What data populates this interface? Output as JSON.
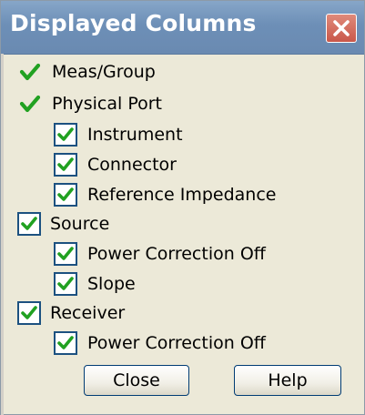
{
  "window": {
    "title": "Displayed Columns",
    "close_icon": "close-x-icon"
  },
  "colors": {
    "titlebar": "#6d8fb7",
    "check_green": "#21a121",
    "box_border": "#1c5180",
    "background": "#ece9d8"
  },
  "items": [
    {
      "label": "Meas/Group",
      "checked": true,
      "style": "plain",
      "icon": "checkmark-icon"
    },
    {
      "label": "Physical Port",
      "checked": true,
      "style": "plain",
      "icon": "checkmark-icon"
    },
    {
      "label": "Instrument",
      "checked": true,
      "style": "checkbox",
      "icon": "checkmark-icon"
    },
    {
      "label": "Connector",
      "checked": true,
      "style": "checkbox",
      "icon": "checkmark-icon"
    },
    {
      "label": "Reference Impedance",
      "checked": true,
      "style": "checkbox",
      "icon": "checkmark-icon"
    },
    {
      "label": "Source",
      "checked": true,
      "style": "checkbox",
      "icon": "checkmark-icon"
    },
    {
      "label": "Power Correction Off",
      "checked": true,
      "style": "checkbox",
      "icon": "checkmark-icon"
    },
    {
      "label": "Slope",
      "checked": true,
      "style": "checkbox",
      "icon": "checkmark-icon"
    },
    {
      "label": "Receiver",
      "checked": true,
      "style": "checkbox",
      "icon": "checkmark-icon"
    },
    {
      "label": "Power Correction Off",
      "checked": true,
      "style": "checkbox",
      "icon": "checkmark-icon"
    }
  ],
  "buttons": {
    "close_label": "Close",
    "help_label": "Help"
  }
}
